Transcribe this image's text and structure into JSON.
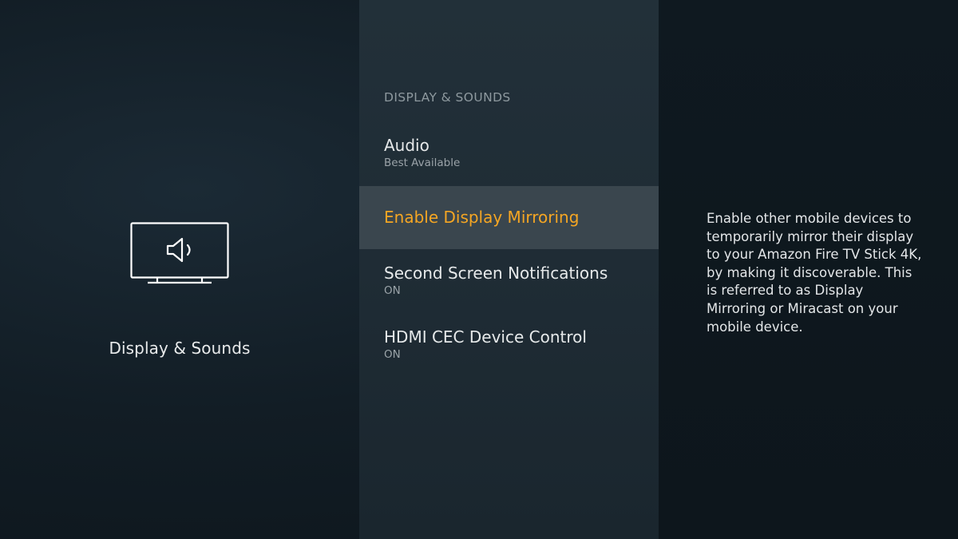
{
  "category": {
    "icon": "tv-speaker-icon",
    "label": "Display & Sounds"
  },
  "menu": {
    "heading": "DISPLAY & SOUNDS",
    "items": [
      {
        "title": "Audio",
        "subtitle": "Best Available",
        "selected": false
      },
      {
        "title": "Enable Display Mirroring",
        "subtitle": "",
        "selected": true
      },
      {
        "title": "Second Screen Notifications",
        "subtitle": "ON",
        "selected": false
      },
      {
        "title": "HDMI CEC Device Control",
        "subtitle": "ON",
        "selected": false
      }
    ]
  },
  "description": "Enable other mobile devices to temporarily mirror their display to your Amazon Fire TV Stick 4K, by making it discoverable. This is referred to as Display Mirroring or Miracast on your mobile device.",
  "colors": {
    "accent": "#f5a623",
    "selected_bg": "#3a464e",
    "text": "#e6e9ea",
    "muted": "#9aa3a8"
  }
}
